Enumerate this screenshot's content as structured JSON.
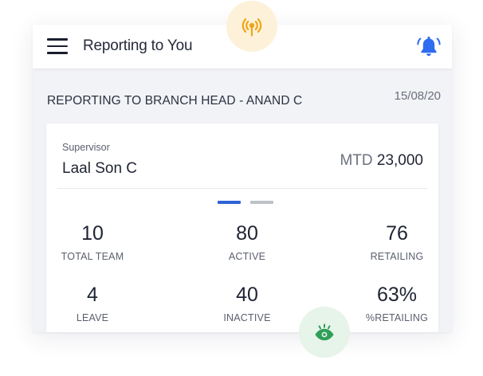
{
  "header": {
    "title": "Reporting to You"
  },
  "report": {
    "heading": "REPORTING TO BRANCH HEAD - ANAND C",
    "date": "15/08/20"
  },
  "card": {
    "supervisor_label": "Supervisor",
    "supervisor_name": "Laal Son C",
    "mtd_label": "MTD",
    "mtd_value": "23,000"
  },
  "pagination": {
    "total": 2,
    "active_index": 0
  },
  "stats": [
    {
      "value": "10",
      "label": "TOTAL TEAM"
    },
    {
      "value": "80",
      "label": "ACTIVE"
    },
    {
      "value": "76",
      "label": "RETAILING"
    },
    {
      "value": "4",
      "label": "LEAVE"
    },
    {
      "value": "40",
      "label": "INACTIVE"
    },
    {
      "value": "63%",
      "label": "%RETAILING"
    }
  ],
  "icons": {
    "menu": "menu-icon",
    "bell": "bell-icon",
    "broadcast": "broadcast-icon",
    "eye": "eye-icon"
  },
  "colors": {
    "accent_blue": "#2f63d7",
    "bell_blue": "#2f6bf0",
    "broadcast_orange": "#f0a417",
    "eye_green": "#2f9e58"
  }
}
